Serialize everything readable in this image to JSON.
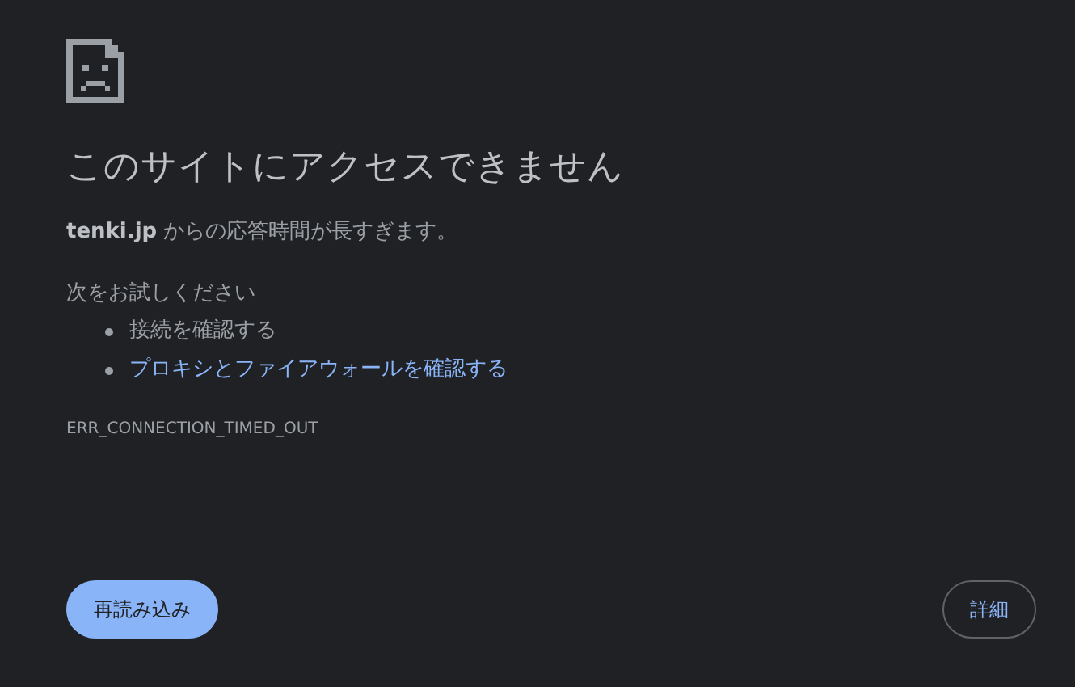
{
  "title": "このサイトにアクセスできません",
  "message": "**tenki.jp** からの応答時間が長すぎます。",
  "suggestions_heading": "次をお試しください",
  "suggestions": [
    {
      "text": "接続を確認する",
      "kind": "text"
    },
    {
      "text": "プロキシとファイアウォールを確認する",
      "kind": "link"
    }
  ],
  "error_code": "ERR_CONNECTION_TIMED_OUT",
  "buttons": [
    {
      "label": "再読み込み",
      "kind": "primary"
    },
    {
      "label": "詳細",
      "kind": "outline"
    }
  ]
}
